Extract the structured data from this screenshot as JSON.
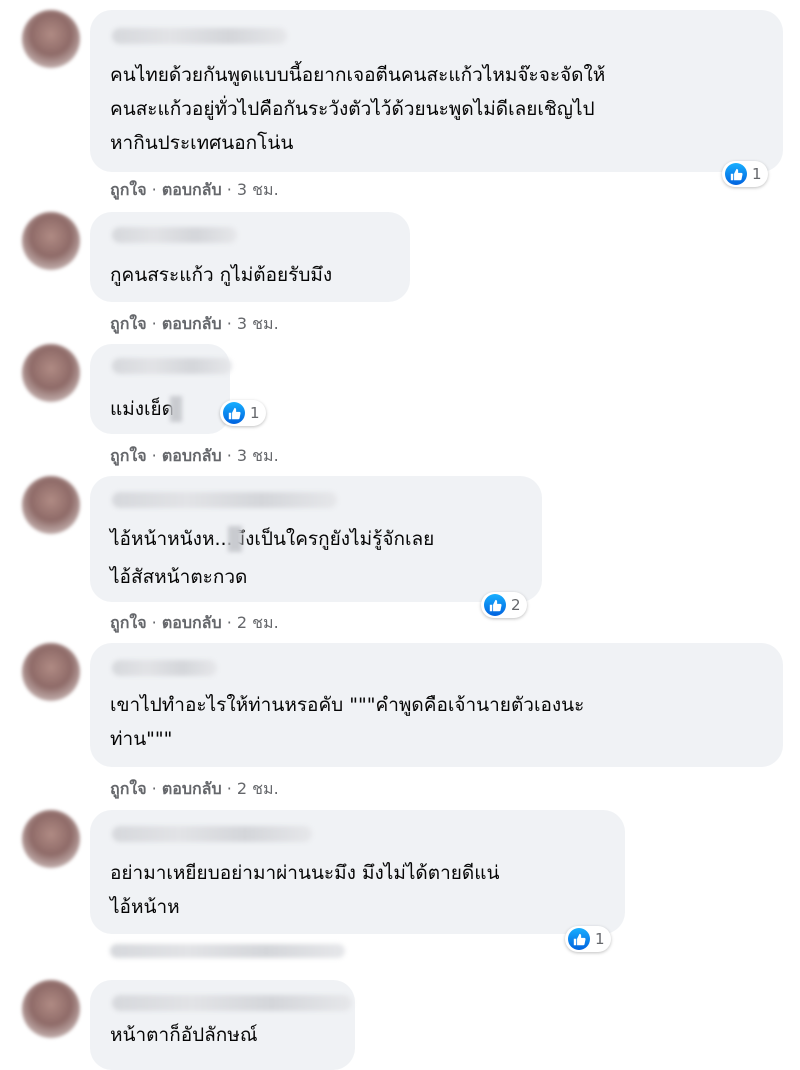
{
  "comments": [
    {
      "lines": [
        "คนไทยด้วยกันพูดแบบนี้อยากเจอตีนคนสะแก้วไหมจ๊ะจะจัดให้",
        "คนสะแก้วอยู่ทั่วไปคือกันระวังตัวไว้ด้วยนะพูดไม่ดีเลยเชิญไป",
        "หากินประเทศนอกโน่น"
      ],
      "like": "ถูกใจ",
      "reply": "ตอบกลับ",
      "time": "3 ชม.",
      "reactions": "1"
    },
    {
      "lines": [
        "กูคนสระแก้ว กูไม่ต้อยรับมึง"
      ],
      "like": "ถูกใจ",
      "reply": "ตอบกลับ",
      "time": "3 ชม."
    },
    {
      "lines": [
        "แม่งเย็ด"
      ],
      "like": "ถูกใจ",
      "reply": "ตอบกลับ",
      "time": "3 ชม.",
      "reactions": "1"
    },
    {
      "lines": [
        "ไอ้หน้าหนังห...มึงเป็นใครกูยังไม่รู้จักเลย",
        "ไอ้สัสหน้าตะกวด"
      ],
      "like": "ถูกใจ",
      "reply": "ตอบกลับ",
      "time": "2 ชม.",
      "reactions": "2"
    },
    {
      "lines": [
        "เขาไปทำอะไรให้ท่านหรอคับ \"\"\"คำพูดคือเจ้านายตัวเองนะ",
        "ท่าน\"\"\""
      ],
      "like": "ถูกใจ",
      "reply": "ตอบกลับ",
      "time": "2 ชม."
    },
    {
      "lines": [
        "อย่ามาเหยียบอย่ามาผ่านนะมึง มึงไม่ได้ตายดีแน่",
        "ไอ้หน้าห"
      ],
      "reactions": "1"
    },
    {
      "lines": [
        "หน้าตาก็อัปลักษณ์"
      ]
    }
  ],
  "separator": " · ",
  "colors": {
    "bubble": "#f0f2f5",
    "like_blue": "#1877f2",
    "meta": "#65676b"
  },
  "icons": {
    "like": "thumbs-up-icon"
  }
}
